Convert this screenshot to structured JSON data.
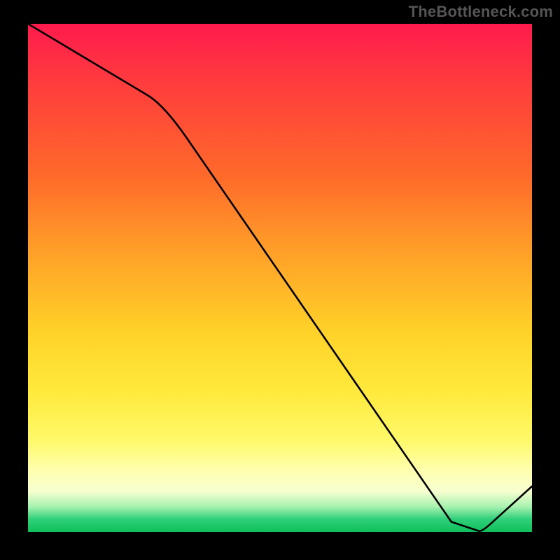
{
  "attribution": "TheBottleneck.com",
  "minimum_label_text": "",
  "chart_data": {
    "type": "line",
    "title": "",
    "xlabel": "",
    "ylabel": "",
    "x": [
      0.0,
      0.27,
      0.84,
      0.9,
      1.0
    ],
    "values": [
      1.0,
      0.84,
      0.02,
      0.0,
      0.09
    ],
    "ylim": [
      0,
      1
    ],
    "xlim": [
      0,
      1
    ],
    "minimum_x": 0.9,
    "background_gradient": [
      "#ff1a4d",
      "#ff6a2a",
      "#ffd028",
      "#ffffb0",
      "#0fbf5a"
    ]
  }
}
